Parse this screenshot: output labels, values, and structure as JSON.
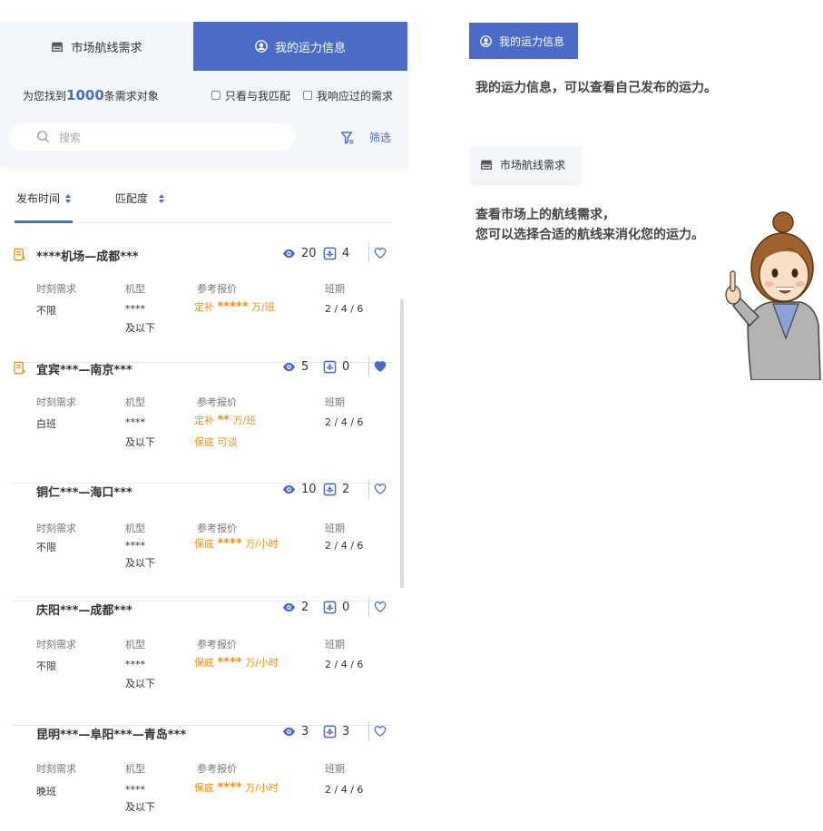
{
  "tabs": [
    {
      "label": "市场航线需求",
      "icon": "store-icon",
      "active": false
    },
    {
      "label": "我的运力信息",
      "icon": "user-circle-icon",
      "active": true
    }
  ],
  "summary": {
    "prefix": "为您找到",
    "count": "1000",
    "suffix": "条需求对象"
  },
  "checkboxes": [
    {
      "label": "只看与我匹配",
      "checked": false
    },
    {
      "label": "我响应过的需求",
      "checked": false
    }
  ],
  "search": {
    "placeholder": "搜索"
  },
  "filter_label": "筛选",
  "sort": {
    "by_time": "发布时间",
    "by_match": "匹配度"
  },
  "columns": {
    "time": "时刻需求",
    "model": "机型",
    "price": "参考报价",
    "schedule": "班期"
  },
  "cards": [
    {
      "route": "****机场—成都***",
      "views": "20",
      "replies": "4",
      "favorited": false,
      "has_icon": true,
      "time": "不限",
      "model": "****",
      "model_sub": "及以下",
      "price_type": "定补",
      "price_stars": "*****",
      "price_unit": "万/班",
      "price2": "",
      "schedule": "2 / 4 / 6"
    },
    {
      "route": "宜宾***—南京***",
      "views": "5",
      "replies": "0",
      "favorited": true,
      "has_icon": true,
      "time": "白班",
      "model": "****",
      "model_sub": "及以下",
      "price_type": "定补",
      "price_stars": "**",
      "price_unit": "万/班",
      "price2": "保底   可谈",
      "schedule": "2 / 4 / 6"
    },
    {
      "route": "铜仁***—海口***",
      "views": "10",
      "replies": "2",
      "favorited": false,
      "has_icon": false,
      "time": "不限",
      "model": "****",
      "model_sub": "及以下",
      "price_type": "保底",
      "price_stars": "****",
      "price_unit": "万/小时",
      "price2": "",
      "schedule": "2 / 4 / 6"
    },
    {
      "route": "庆阳***—成都***",
      "views": "2",
      "replies": "0",
      "favorited": false,
      "has_icon": false,
      "time": "不限",
      "model": "****",
      "model_sub": "及以下",
      "price_type": "保底",
      "price_stars": "****",
      "price_unit": "万/小时",
      "price2": "",
      "schedule": "2 / 4 / 6"
    },
    {
      "route": "昆明***—阜阳***—青岛***",
      "views": "3",
      "replies": "3",
      "favorited": false,
      "has_icon": false,
      "time": "晚班",
      "model": "****",
      "model_sub": "及以下",
      "price_type": "保底",
      "price_stars": "****",
      "price_unit": "万/小时",
      "price2": "",
      "schedule": "2 / 4 / 6"
    }
  ],
  "right": {
    "tag1": "我的运力信息",
    "text1": "我的运力信息，可以查看自己发布的运力。",
    "tag2": "市场航线需求",
    "text2_line1": "查看市场上的航线需求，",
    "text2_line2": "您可以选择合适的航线来消化您的运力。"
  },
  "colors": {
    "accent": "#4a6bc6",
    "price": "#f0900b",
    "panel_bg": "#f3f6fb"
  }
}
